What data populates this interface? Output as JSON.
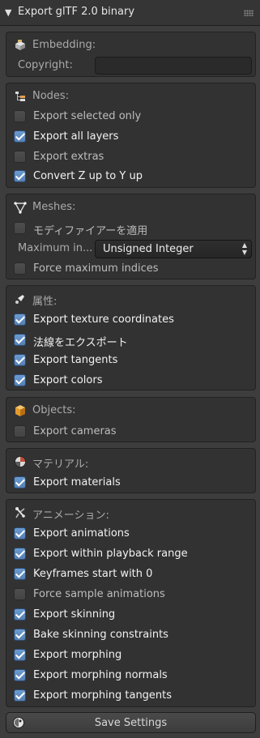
{
  "header": {
    "title": "Export glTF 2.0 binary"
  },
  "embedding": {
    "title": "Embedding:",
    "copyright_label": "Copyright:",
    "copyright_value": ""
  },
  "nodes": {
    "title": "Nodes:",
    "items": [
      {
        "label": "Export selected only",
        "checked": false
      },
      {
        "label": "Export all layers",
        "checked": true
      },
      {
        "label": "Export extras",
        "checked": false
      },
      {
        "label": "Convert Z up to Y up",
        "checked": true
      }
    ]
  },
  "meshes": {
    "title": "Meshes:",
    "apply_modifiers": {
      "label": "モディファイアーを適用",
      "checked": false
    },
    "max_indices_label": "Maximum in...",
    "max_indices_value": "Unsigned Integer",
    "force_max": {
      "label": "Force maximum indices",
      "checked": false
    }
  },
  "attributes": {
    "title": "属性:",
    "items": [
      {
        "label": "Export texture coordinates",
        "checked": true
      },
      {
        "label": "法線をエクスポート",
        "checked": true
      },
      {
        "label": "Export tangents",
        "checked": true
      },
      {
        "label": "Export colors",
        "checked": true
      }
    ]
  },
  "objects": {
    "title": "Objects:",
    "items": [
      {
        "label": "Export cameras",
        "checked": false
      }
    ]
  },
  "material": {
    "title": "マテリアル:",
    "items": [
      {
        "label": "Export materials",
        "checked": true
      }
    ]
  },
  "animation": {
    "title": "アニメーション:",
    "items": [
      {
        "label": "Export animations",
        "checked": true
      },
      {
        "label": "Export within playback range",
        "checked": true
      },
      {
        "label": "Keyframes start with 0",
        "checked": true
      },
      {
        "label": "Force sample animations",
        "checked": false
      },
      {
        "label": "Export skinning",
        "checked": true
      },
      {
        "label": "Bake skinning constraints",
        "checked": true
      },
      {
        "label": "Export morphing",
        "checked": true
      },
      {
        "label": "Export morphing normals",
        "checked": true
      },
      {
        "label": "Export morphing tangents",
        "checked": true
      }
    ]
  },
  "save": {
    "label": "Save Settings"
  },
  "colors": {
    "accent": "#5f8fc7",
    "panel": "#323232",
    "background": "#3d3d3d"
  },
  "icons": {
    "embedding": "package-icon",
    "nodes": "outliner-icon",
    "meshes": "mesh-icon",
    "attributes": "attribute-icon",
    "objects": "cube-icon",
    "material": "material-sphere-icon",
    "animation": "armature-icon",
    "save": "preset-icon"
  }
}
